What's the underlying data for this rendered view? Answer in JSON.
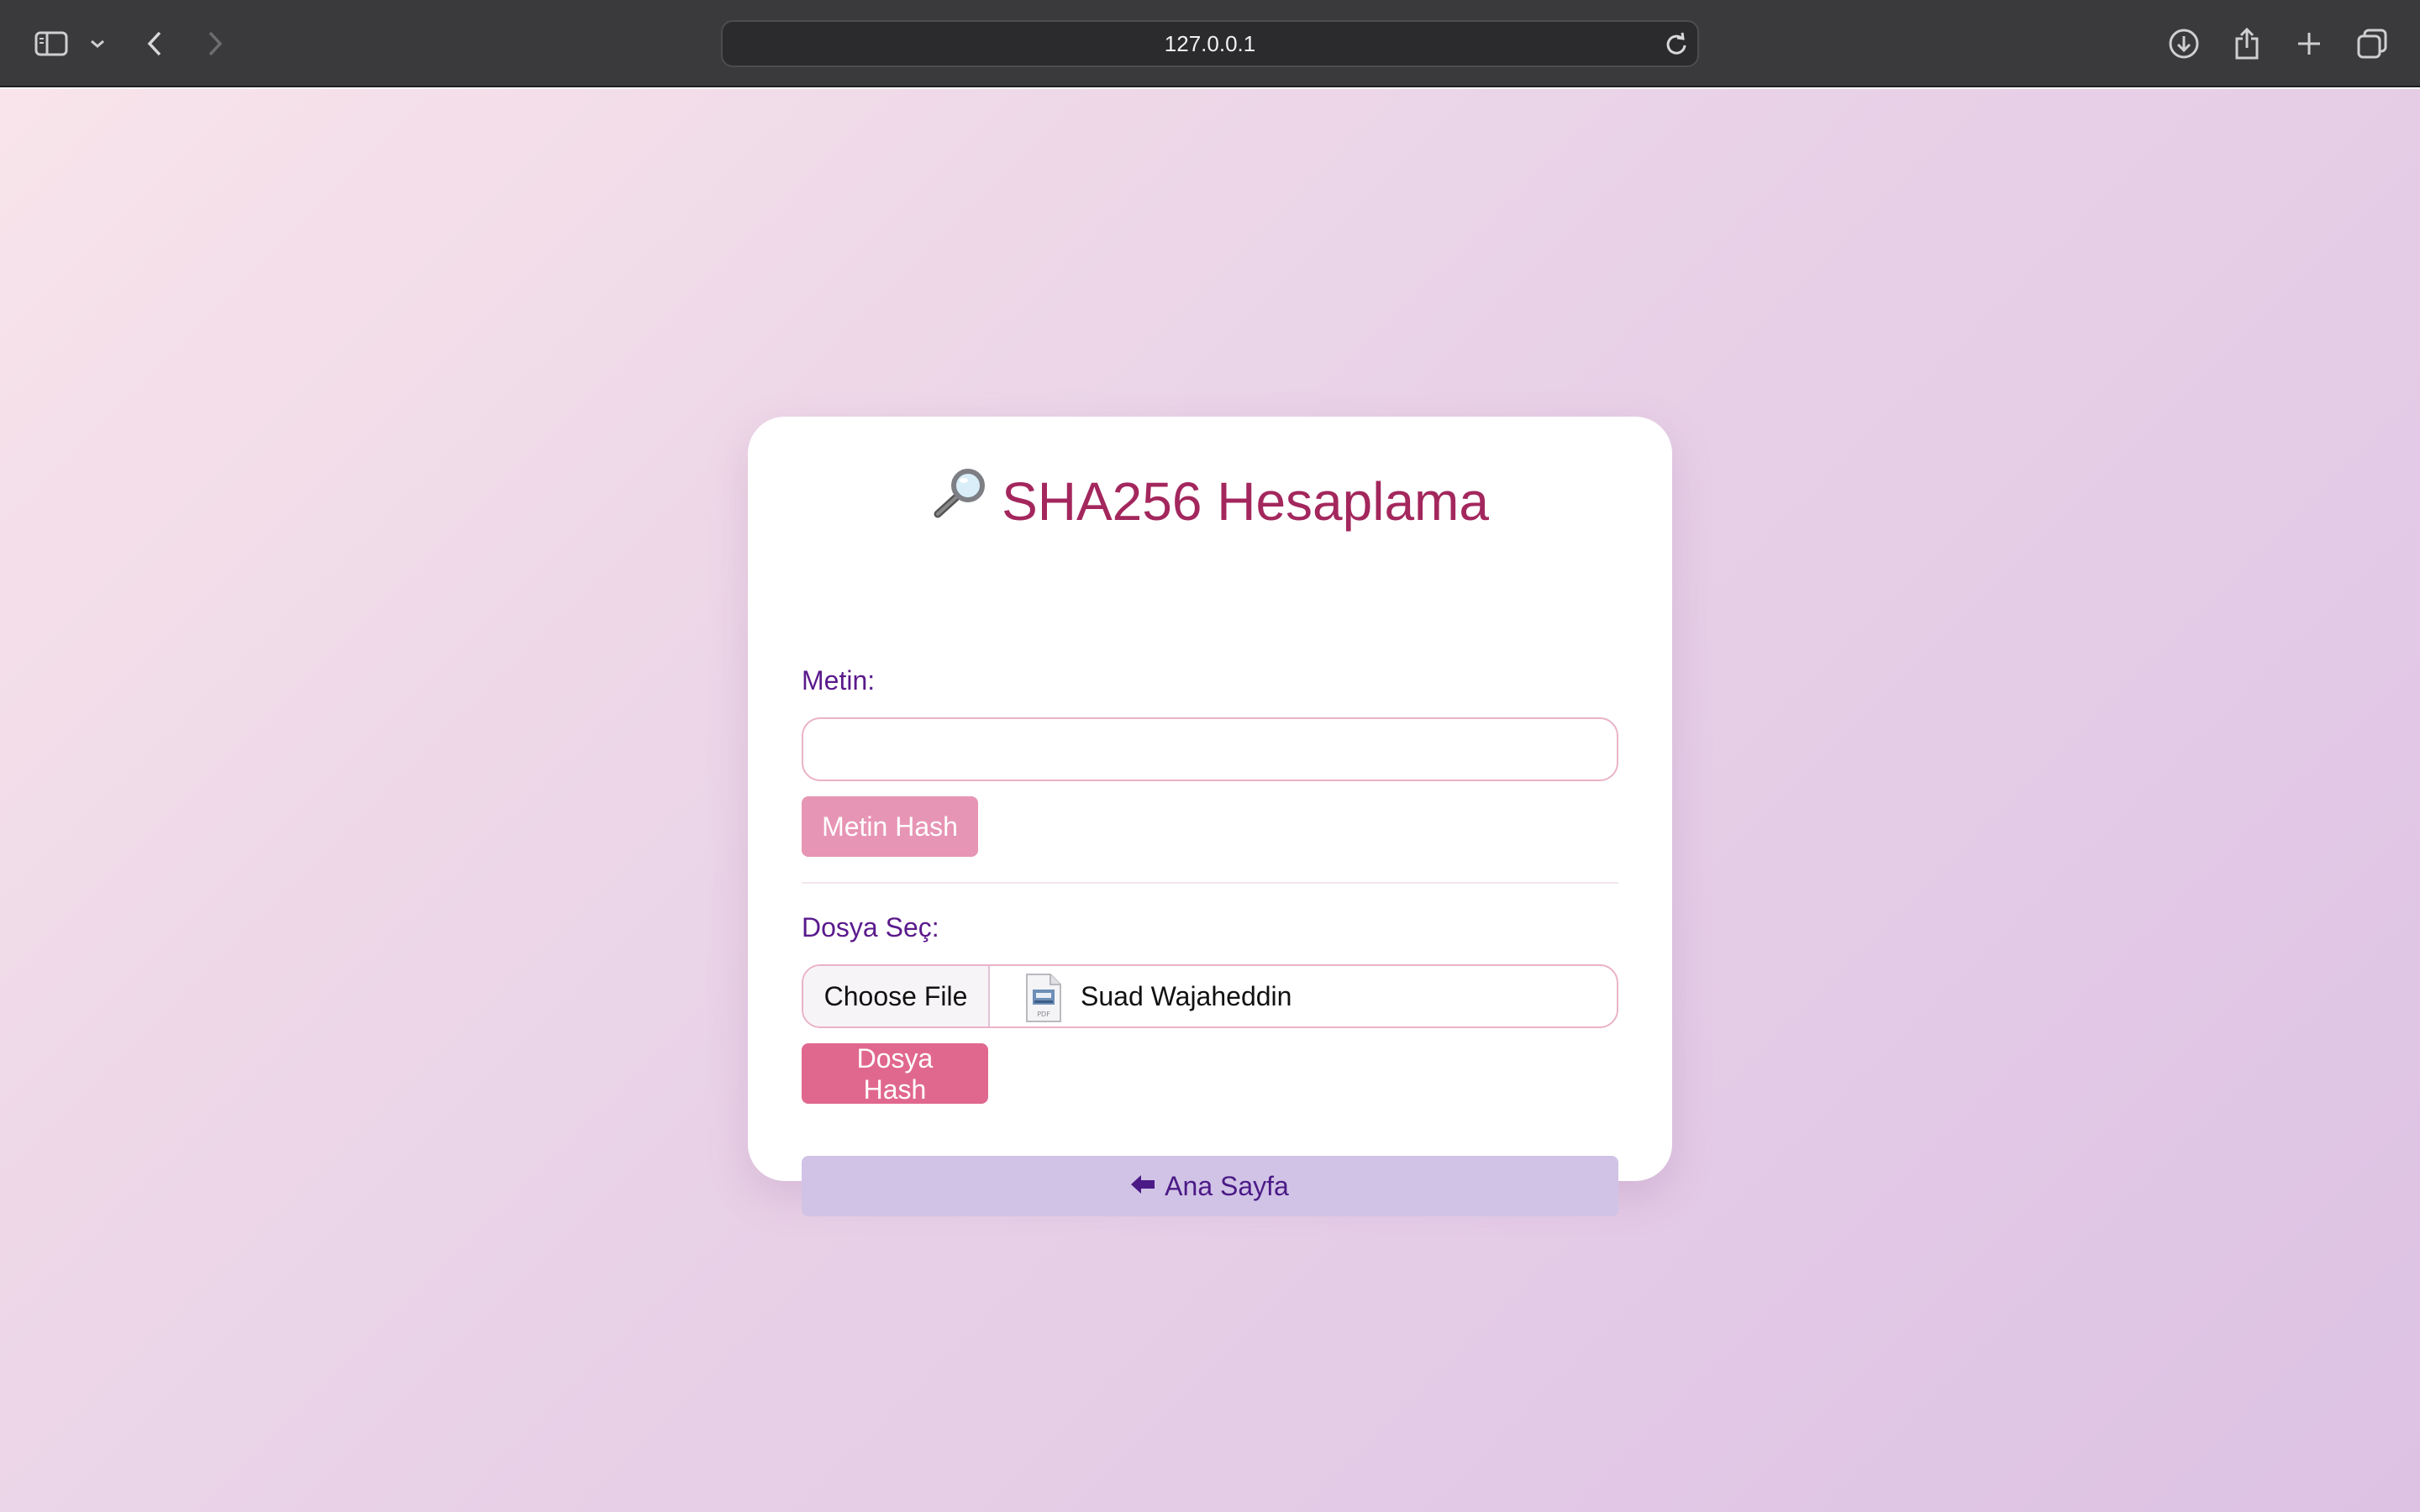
{
  "browser": {
    "url": "127.0.0.1"
  },
  "card": {
    "title": "SHA256 Hesaplama",
    "title_icon": "magnifying-glass-icon",
    "text_section": {
      "label": "Metin:",
      "input_value": "",
      "input_placeholder": "",
      "button_label": "Metin Hash"
    },
    "file_section": {
      "label": "Dosya Seç:",
      "choose_button_label": "Choose File",
      "file_icon": "pdf-file-icon",
      "file_name": "Suad Wajaheddin",
      "button_label": "Dosya Hash"
    },
    "home_button": {
      "icon": "left-arrow-icon",
      "label": "Ana Sayfa"
    }
  },
  "colors": {
    "title": "#a3275d",
    "label": "#5a1a8c",
    "metin_button": "#e795b4",
    "dosya_button": "#e0688f",
    "home_button_bg": "#d1c3e6",
    "home_button_text": "#4b1a86",
    "browser_toolbar": "#3a3a3c"
  }
}
